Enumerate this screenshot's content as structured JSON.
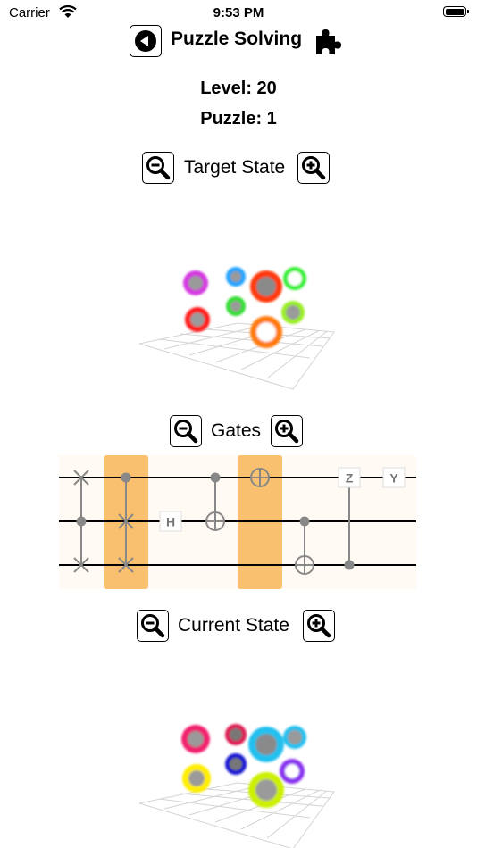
{
  "status_bar": {
    "carrier": "Carrier",
    "time": "9:53 PM",
    "wifi_icon": "wifi-icon",
    "battery_icon": "battery-full-icon"
  },
  "header": {
    "title": "Puzzle Solving",
    "back_icon": "back-arrow-icon",
    "puzzle_icon": "puzzle-piece-icon"
  },
  "info": {
    "level": "Level: 20",
    "puzzle": "Puzzle: 1"
  },
  "sections": {
    "target": "Target State",
    "gates": "Gates",
    "current": "Current State"
  },
  "gates": {
    "h_label": "H",
    "z_label": "Z",
    "y_label": "Y",
    "highlight_color": "#f9c06f"
  },
  "target_state": {
    "ball_colors": [
      "#d43ae0",
      "#ff1a1a",
      "#22a3ff",
      "#33dd33",
      "#ff3b10",
      "#33ee33",
      "#ff7a10",
      "#99ee22"
    ]
  },
  "current_state": {
    "ball_colors": [
      "#f0226e",
      "#ffee00",
      "#dd1f55",
      "#1414d0",
      "#22c0ee",
      "#22c0ee",
      "#8833ee",
      "#ccf000"
    ]
  }
}
